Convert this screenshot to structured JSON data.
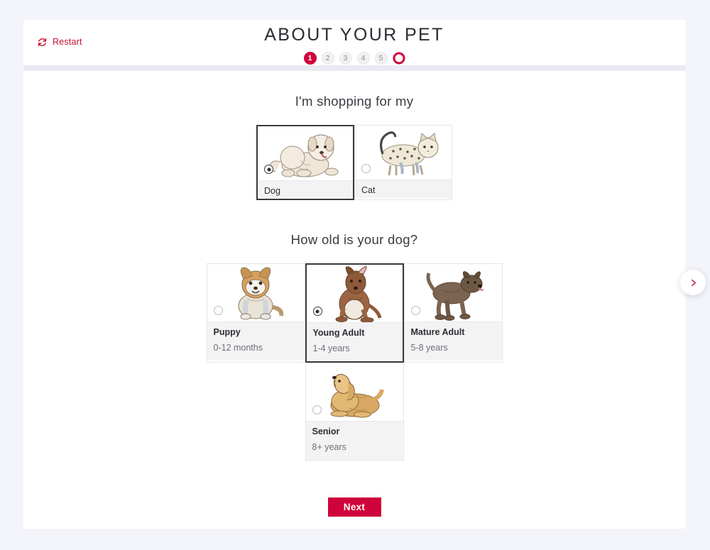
{
  "header": {
    "title": "ABOUT YOUR PET",
    "restart_label": "Restart",
    "restart_icon": "refresh-icon",
    "accent_color": "#d0023c",
    "steps": [
      {
        "label": "1",
        "state": "active"
      },
      {
        "label": "2",
        "state": "inactive"
      },
      {
        "label": "3",
        "state": "inactive"
      },
      {
        "label": "4",
        "state": "inactive"
      },
      {
        "label": "5",
        "state": "inactive"
      },
      {
        "label": "",
        "state": "finish"
      }
    ]
  },
  "main": {
    "question_pet": "I'm shopping for my",
    "question_age": "How old is your dog?",
    "pet_options": [
      {
        "label": "Dog",
        "selected": true,
        "art": "dog-illustration"
      },
      {
        "label": "Cat",
        "selected": false,
        "art": "cat-illustration"
      }
    ],
    "age_options": [
      {
        "label": "Puppy",
        "sub": "0-12 months",
        "selected": false,
        "art": "puppy-illustration"
      },
      {
        "label": "Young Adult",
        "sub": "1-4 years",
        "selected": true,
        "art": "young-adult-dog-illustration"
      },
      {
        "label": "Mature Adult",
        "sub": "5-8 years",
        "selected": false,
        "art": "mature-adult-dog-illustration"
      },
      {
        "label": "Senior",
        "sub": "8+ years",
        "selected": false,
        "art": "senior-dog-illustration"
      }
    ],
    "next_label": "Next",
    "float_arrow_icon": "chevron-right-icon"
  }
}
